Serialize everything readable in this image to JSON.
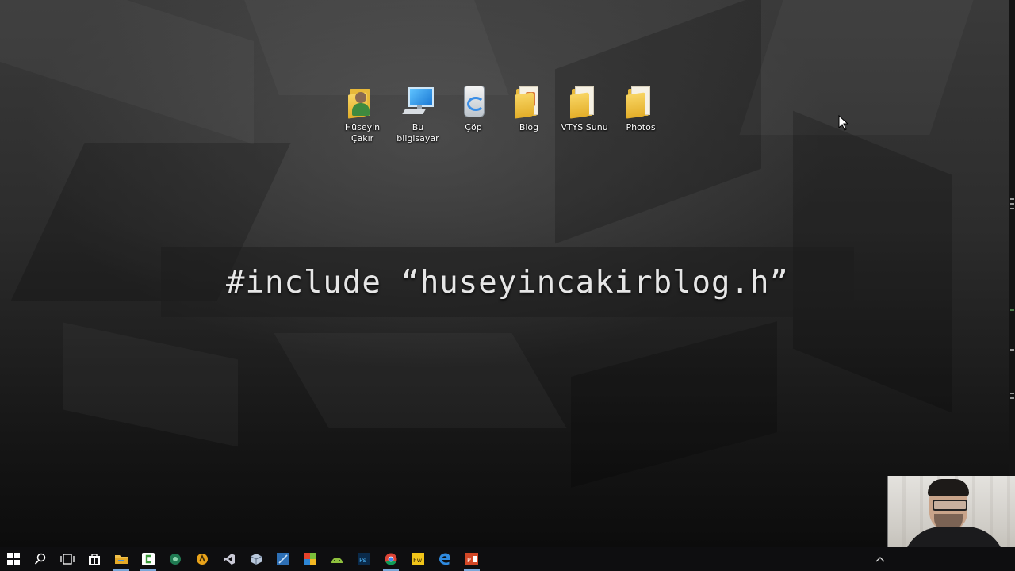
{
  "desktop": {
    "icons": [
      {
        "label": "Hüseyin Çakır",
        "line1": "Hüseyin",
        "line2": "Çakır",
        "icon": "user-folder-icon"
      },
      {
        "label": "Bu bilgisayar",
        "icon": "computer-icon"
      },
      {
        "label": "Çöp",
        "icon": "recycle-bin-icon"
      },
      {
        "label": "Blog",
        "icon": "folder-icon"
      },
      {
        "label": "VTYS Sunu",
        "icon": "folder-icon"
      },
      {
        "label": "Photos",
        "icon": "folder-icon"
      }
    ]
  },
  "banner": {
    "text": "#include “huseyincakirblog.h”"
  },
  "taskbar": {
    "apps": [
      {
        "name": "start-button",
        "icon": "windows-logo-icon"
      },
      {
        "name": "search-button",
        "icon": "search-icon"
      },
      {
        "name": "task-view-button",
        "icon": "task-view-icon"
      },
      {
        "name": "store-button",
        "icon": "store-icon"
      },
      {
        "name": "file-explorer-button",
        "icon": "file-explorer-icon"
      },
      {
        "name": "camtasia-button",
        "icon": "camtasia-icon"
      },
      {
        "name": "app-green-button",
        "icon": "green-app-icon"
      },
      {
        "name": "app-yellow-button",
        "icon": "yellow-app-icon"
      },
      {
        "name": "visual-studio-button",
        "icon": "visual-studio-icon"
      },
      {
        "name": "app-cube-button",
        "icon": "cube-icon"
      },
      {
        "name": "app-blue-button",
        "icon": "blue-app-icon"
      },
      {
        "name": "app-colorful-button",
        "icon": "multicolor-app-icon"
      },
      {
        "name": "android-button",
        "icon": "android-icon"
      },
      {
        "name": "photoshop-button",
        "icon": "photoshop-icon"
      },
      {
        "name": "chrome-button",
        "icon": "chrome-icon"
      },
      {
        "name": "fireworks-button",
        "icon": "fireworks-icon"
      },
      {
        "name": "edge-button",
        "icon": "edge-icon"
      },
      {
        "name": "powerpoint-button",
        "icon": "powerpoint-icon"
      }
    ],
    "tray": {
      "icon": "chevron-up-icon"
    }
  },
  "colors": {
    "accent": "#7aa7d9",
    "folder": "#e8b93a",
    "taskbar": "#0e0e10"
  }
}
